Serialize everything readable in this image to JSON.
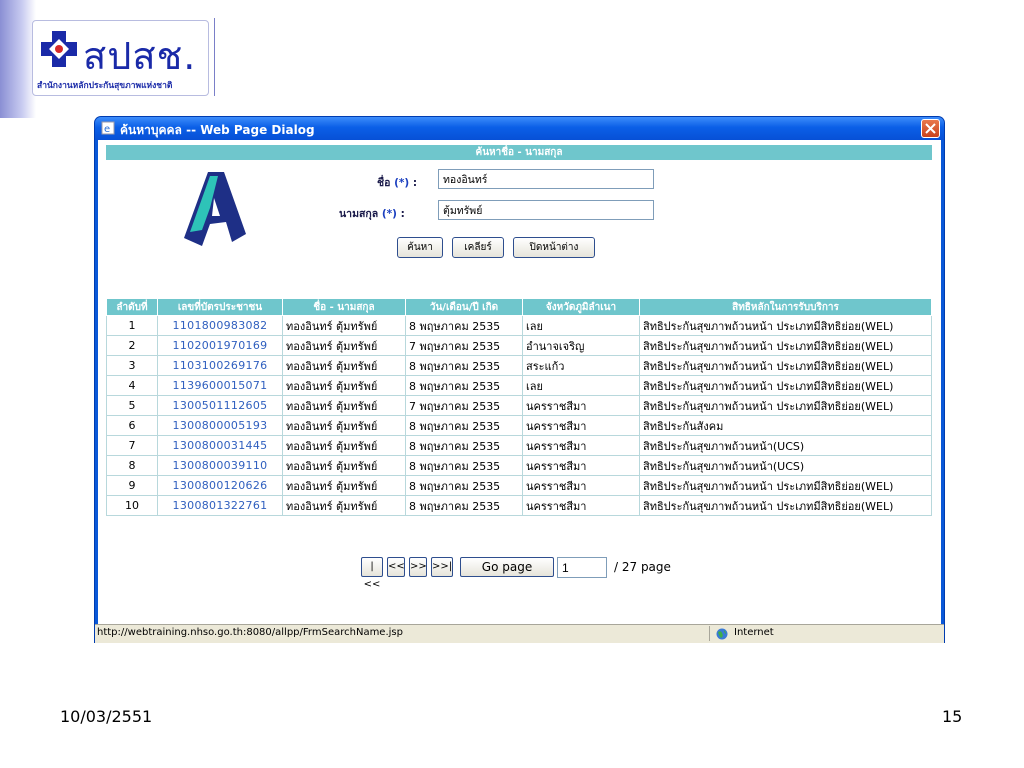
{
  "logo": {
    "word": "สปสช.",
    "subtitle": "สำนักงานหลักประกันสุขภาพแห่งชาติ"
  },
  "dialog": {
    "title": "ค้นหาบุคคล -- Web Page Dialog",
    "section_header": "ค้นหาชื่อ - นามสกุล",
    "form": {
      "first_name_label": "ชื่อ",
      "last_name_label": "นามสกุล",
      "required_mark": "(*)",
      "colon": ":",
      "first_name_value": "ทองอินทร์",
      "last_name_value": "ตุ้มทรัพย์"
    },
    "buttons": {
      "search": "ค้นหา",
      "clear": "เคลียร์",
      "close": "ปิดหน้าต่าง"
    },
    "table": {
      "columns": [
        "ลำดับที่",
        "เลขที่บัตรประชาชน",
        "ชื่อ - นามสกุล",
        "วัน/เดือน/ปี เกิด",
        "จังหวัดภูมิลำเนา",
        "สิทธิหลักในการรับบริการ"
      ],
      "rows": [
        {
          "no": "1",
          "id": "1101800983082",
          "name": "ทองอินทร์ ตุ้มทรัพย์",
          "dob": "8 พฤษภาคม 2535",
          "province": "เลย",
          "right": "สิทธิประกันสุขภาพถ้วนหน้า ประเภทมีสิทธิย่อย(WEL)"
        },
        {
          "no": "2",
          "id": "1102001970169",
          "name": "ทองอินทร์ ตุ้มทรัพย์",
          "dob": "7 พฤษภาคม 2535",
          "province": "อำนาจเจริญ",
          "right": "สิทธิประกันสุขภาพถ้วนหน้า ประเภทมีสิทธิย่อย(WEL)"
        },
        {
          "no": "3",
          "id": "1103100269176",
          "name": "ทองอินทร์ ตุ้มทรัพย์",
          "dob": "8 พฤษภาคม 2535",
          "province": "สระแก้ว",
          "right": "สิทธิประกันสุขภาพถ้วนหน้า ประเภทมีสิทธิย่อย(WEL)"
        },
        {
          "no": "4",
          "id": "1139600015071",
          "name": "ทองอินทร์ ตุ้มทรัพย์",
          "dob": "8 พฤษภาคม 2535",
          "province": "เลย",
          "right": "สิทธิประกันสุขภาพถ้วนหน้า ประเภทมีสิทธิย่อย(WEL)"
        },
        {
          "no": "5",
          "id": "1300501112605",
          "name": "ทองอินทร์ ตุ้มทรัพย์",
          "dob": "7 พฤษภาคม 2535",
          "province": "นครราชสีมา",
          "right": "สิทธิประกันสุขภาพถ้วนหน้า ประเภทมีสิทธิย่อย(WEL)"
        },
        {
          "no": "6",
          "id": "1300800005193",
          "name": "ทองอินทร์ ตุ้มทรัพย์",
          "dob": "8 พฤษภาคม 2535",
          "province": "นครราชสีมา",
          "right": "สิทธิประกันสังคม"
        },
        {
          "no": "7",
          "id": "1300800031445",
          "name": "ทองอินทร์ ตุ้มทรัพย์",
          "dob": "8 พฤษภาคม 2535",
          "province": "นครราชสีมา",
          "right": "สิทธิประกันสุขภาพถ้วนหน้า(UCS)"
        },
        {
          "no": "8",
          "id": "1300800039110",
          "name": "ทองอินทร์ ตุ้มทรัพย์",
          "dob": "8 พฤษภาคม 2535",
          "province": "นครราชสีมา",
          "right": "สิทธิประกันสุขภาพถ้วนหน้า(UCS)"
        },
        {
          "no": "9",
          "id": "1300800120626",
          "name": "ทองอินทร์ ตุ้มทรัพย์",
          "dob": "8 พฤษภาคม 2535",
          "province": "นครราชสีมา",
          "right": "สิทธิประกันสุขภาพถ้วนหน้า ประเภทมีสิทธิย่อย(WEL)"
        },
        {
          "no": "10",
          "id": "1300801322761",
          "name": "ทองอินทร์ ตุ้มทรัพย์",
          "dob": "8 พฤษภาคม 2535",
          "province": "นครราชสีมา",
          "right": "สิทธิประกันสุขภาพถ้วนหน้า ประเภทมีสิทธิย่อย(WEL)"
        }
      ]
    },
    "pager": {
      "first": "|<<",
      "prev": "<<",
      "next": ">>",
      "last": ">>|",
      "go_label": "Go page",
      "page_value": "1",
      "total_text": "/ 27 page"
    },
    "statusbar": {
      "url": "http://webtraining.nhso.go.th:8080/allpp/FrmSearchName.jsp",
      "zone": "Internet"
    }
  },
  "footer": {
    "date": "10/03/2551",
    "page_number": "15"
  },
  "colors": {
    "title_bar": "#0b5fe7",
    "header_teal": "#6fc6cc",
    "link_blue": "#2f5fbf",
    "logo_blue": "#1a2aa8"
  }
}
